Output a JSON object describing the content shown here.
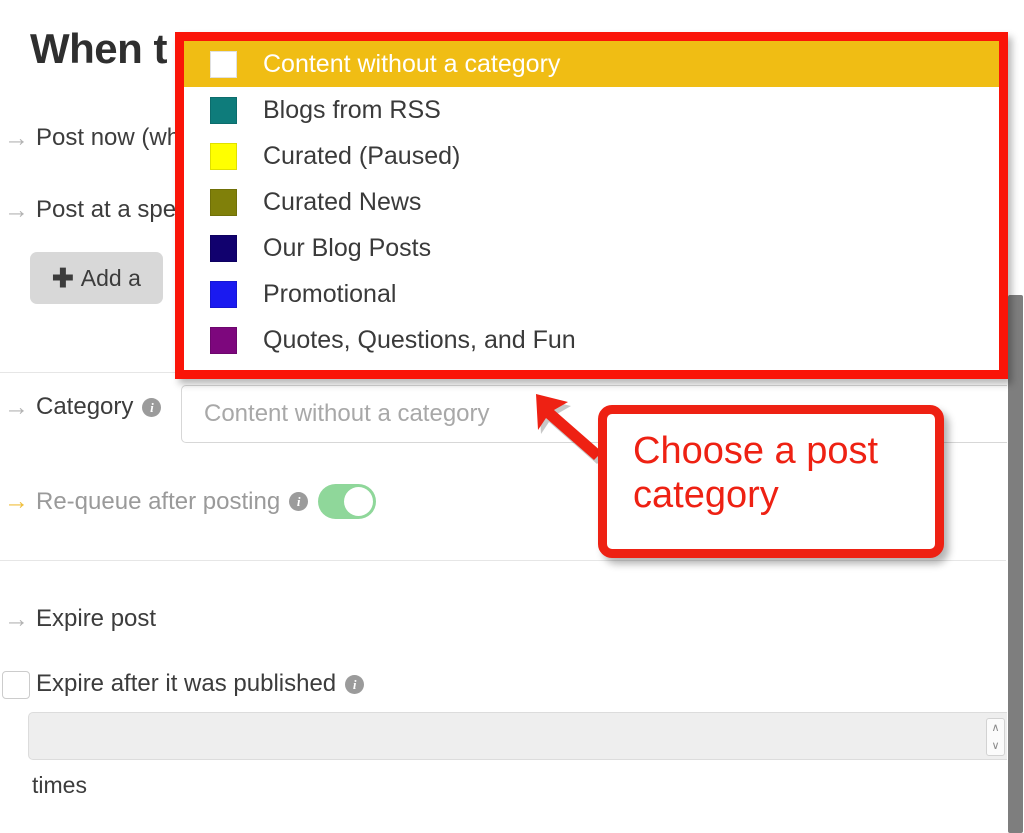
{
  "page": {
    "title": "When t"
  },
  "rows": {
    "post_now": "Post now (wh",
    "post_specific": "Post at a spe",
    "add_button": "Add a",
    "add_button_icon": "plus-icon",
    "category_label": "Category",
    "category_placeholder": "Content without a category",
    "requeue_label": "Re-queue after posting",
    "requeue_toggle_state": "on",
    "expire_label": "Expire post",
    "expire_checkbox_label": "Expire after it was published",
    "expire_checkbox_state": "unchecked",
    "expire_count_value": "",
    "times_label": "times"
  },
  "dropdown": {
    "items": [
      {
        "label": "Content without a category",
        "swatch": "#ffffff",
        "selected": true
      },
      {
        "label": "Blogs from RSS",
        "swatch": "#0e7c7b",
        "selected": false
      },
      {
        "label": "Curated (Paused)",
        "swatch": "#ffff00",
        "selected": false
      },
      {
        "label": "Curated News",
        "swatch": "#80800a",
        "selected": false
      },
      {
        "label": "Our Blog Posts",
        "swatch": "#11016e",
        "selected": false
      },
      {
        "label": "Promotional",
        "swatch": "#1a1af0",
        "selected": false
      },
      {
        "label": "Quotes, Questions, and Fun",
        "swatch": "#7d077d",
        "selected": false
      }
    ],
    "highlight_color": "#f0bd14",
    "outline_color": "#fa1408"
  },
  "callout": {
    "line1": "Choose a post",
    "line2": "category",
    "color": "#ee2113"
  },
  "icons": {
    "row_arrow": "→",
    "info": "i",
    "spinner_up": "∧",
    "spinner_down": "∨"
  }
}
